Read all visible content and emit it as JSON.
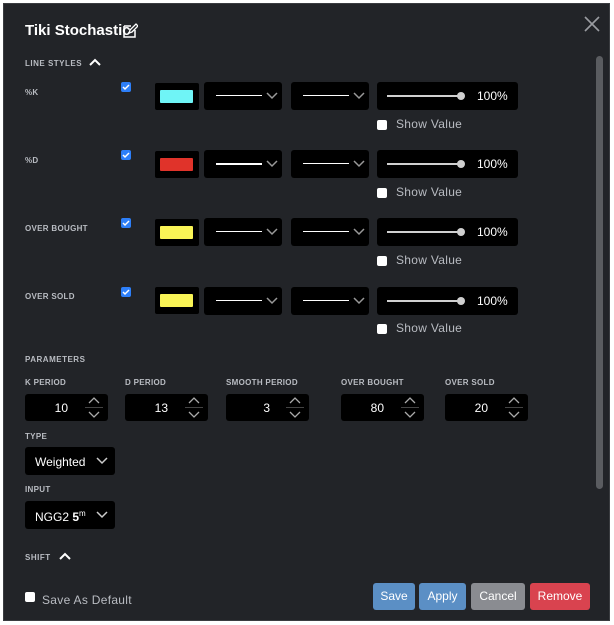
{
  "dialog": {
    "title": "Tiki Stochastic",
    "icons": {
      "edit": "edit-icon",
      "close": "close-icon"
    }
  },
  "line_styles": {
    "label": "LINE STYLES",
    "show_value_label": "Show Value",
    "rows": [
      {
        "label": "%K",
        "color": "#6ff4f6",
        "opacity": "100%",
        "checked": true,
        "show_value": false
      },
      {
        "label": "%D",
        "color": "#e0332a",
        "opacity": "100%",
        "checked": true,
        "show_value": false
      },
      {
        "label": "OVER BOUGHT",
        "color": "#f9f456",
        "opacity": "100%",
        "checked": true,
        "show_value": false
      },
      {
        "label": "OVER SOLD",
        "color": "#f9f456",
        "opacity": "100%",
        "checked": true,
        "show_value": false
      }
    ]
  },
  "parameters": {
    "label": "PARAMETERS",
    "fields": [
      {
        "label": "K PERIOD",
        "value": "10"
      },
      {
        "label": "D PERIOD",
        "value": "13"
      },
      {
        "label": "SMOOTH PERIOD",
        "value": "3"
      },
      {
        "label": "OVER BOUGHT",
        "value": "80"
      },
      {
        "label": "OVER SOLD",
        "value": "20"
      }
    ],
    "type": {
      "label": "TYPE",
      "value": "Weighted"
    },
    "input": {
      "label": "INPUT",
      "value": "NGG2",
      "bold": "5",
      "sup": "m"
    }
  },
  "shift": {
    "label": "SHIFT"
  },
  "footer": {
    "save_default_label": "Save As Default",
    "buttons": {
      "save": "Save",
      "apply": "Apply",
      "cancel": "Cancel",
      "remove": "Remove"
    },
    "colors": {
      "save": "#5b8fc5",
      "apply": "#5b8fc5",
      "cancel": "#8a8c91",
      "remove": "#d9434f"
    }
  },
  "accent": "#2d7ff9"
}
